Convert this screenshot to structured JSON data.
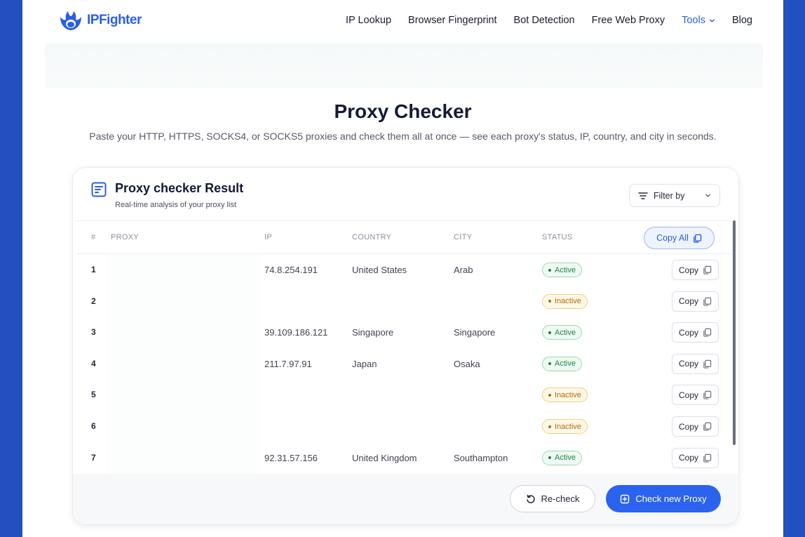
{
  "header": {
    "brand": "IPFighter",
    "nav": [
      {
        "label": "IP Lookup"
      },
      {
        "label": "Browser Fingerprint"
      },
      {
        "label": "Bot Detection"
      },
      {
        "label": "Free Web Proxy"
      },
      {
        "label": "Tools"
      },
      {
        "label": "Blog"
      }
    ]
  },
  "hero": {
    "title": "Proxy Checker",
    "subtitle": "Paste your HTTP, HTTPS, SOCKS4, or SOCKS5 proxies and check them all at once — see each proxy's status, IP, country, and city in seconds."
  },
  "result": {
    "title": "Proxy checker Result",
    "subtitle": "Real-time analysis of your proxy list",
    "filter_label": "Filter by",
    "copy_all_label": "Copy All",
    "columns": [
      "#",
      "PROXY",
      "IP",
      "COUNTRY",
      "CITY",
      "STATUS"
    ],
    "copy_label": "Copy",
    "rows": [
      {
        "num": "1",
        "proxy": "",
        "ip": "74.8.254.191",
        "country": "United States",
        "city": "Arab",
        "status": "Active"
      },
      {
        "num": "2",
        "proxy": "",
        "ip": "",
        "country": "",
        "city": "",
        "status": "Inactive"
      },
      {
        "num": "3",
        "proxy": "",
        "ip": "39.109.186.121",
        "country": "Singapore",
        "city": "Singapore",
        "status": "Active"
      },
      {
        "num": "4",
        "proxy": "",
        "ip": "211.7.97.91",
        "country": "Japan",
        "city": "Osaka",
        "status": "Active"
      },
      {
        "num": "5",
        "proxy": "",
        "ip": "",
        "country": "",
        "city": "",
        "status": "Inactive"
      },
      {
        "num": "6",
        "proxy": "",
        "ip": "",
        "country": "",
        "city": "",
        "status": "Inactive"
      },
      {
        "num": "7",
        "proxy": "",
        "ip": "92.31.57.156",
        "country": "United Kingdom",
        "city": "Southampton",
        "status": "Active"
      }
    ],
    "recheck_label": "Re-check",
    "check_new_label": "Check new Proxy"
  },
  "colors": {
    "brand": "#2b5fe3",
    "page_bg": "#2350c0",
    "active": "#24804a",
    "inactive": "#b46a0c"
  }
}
